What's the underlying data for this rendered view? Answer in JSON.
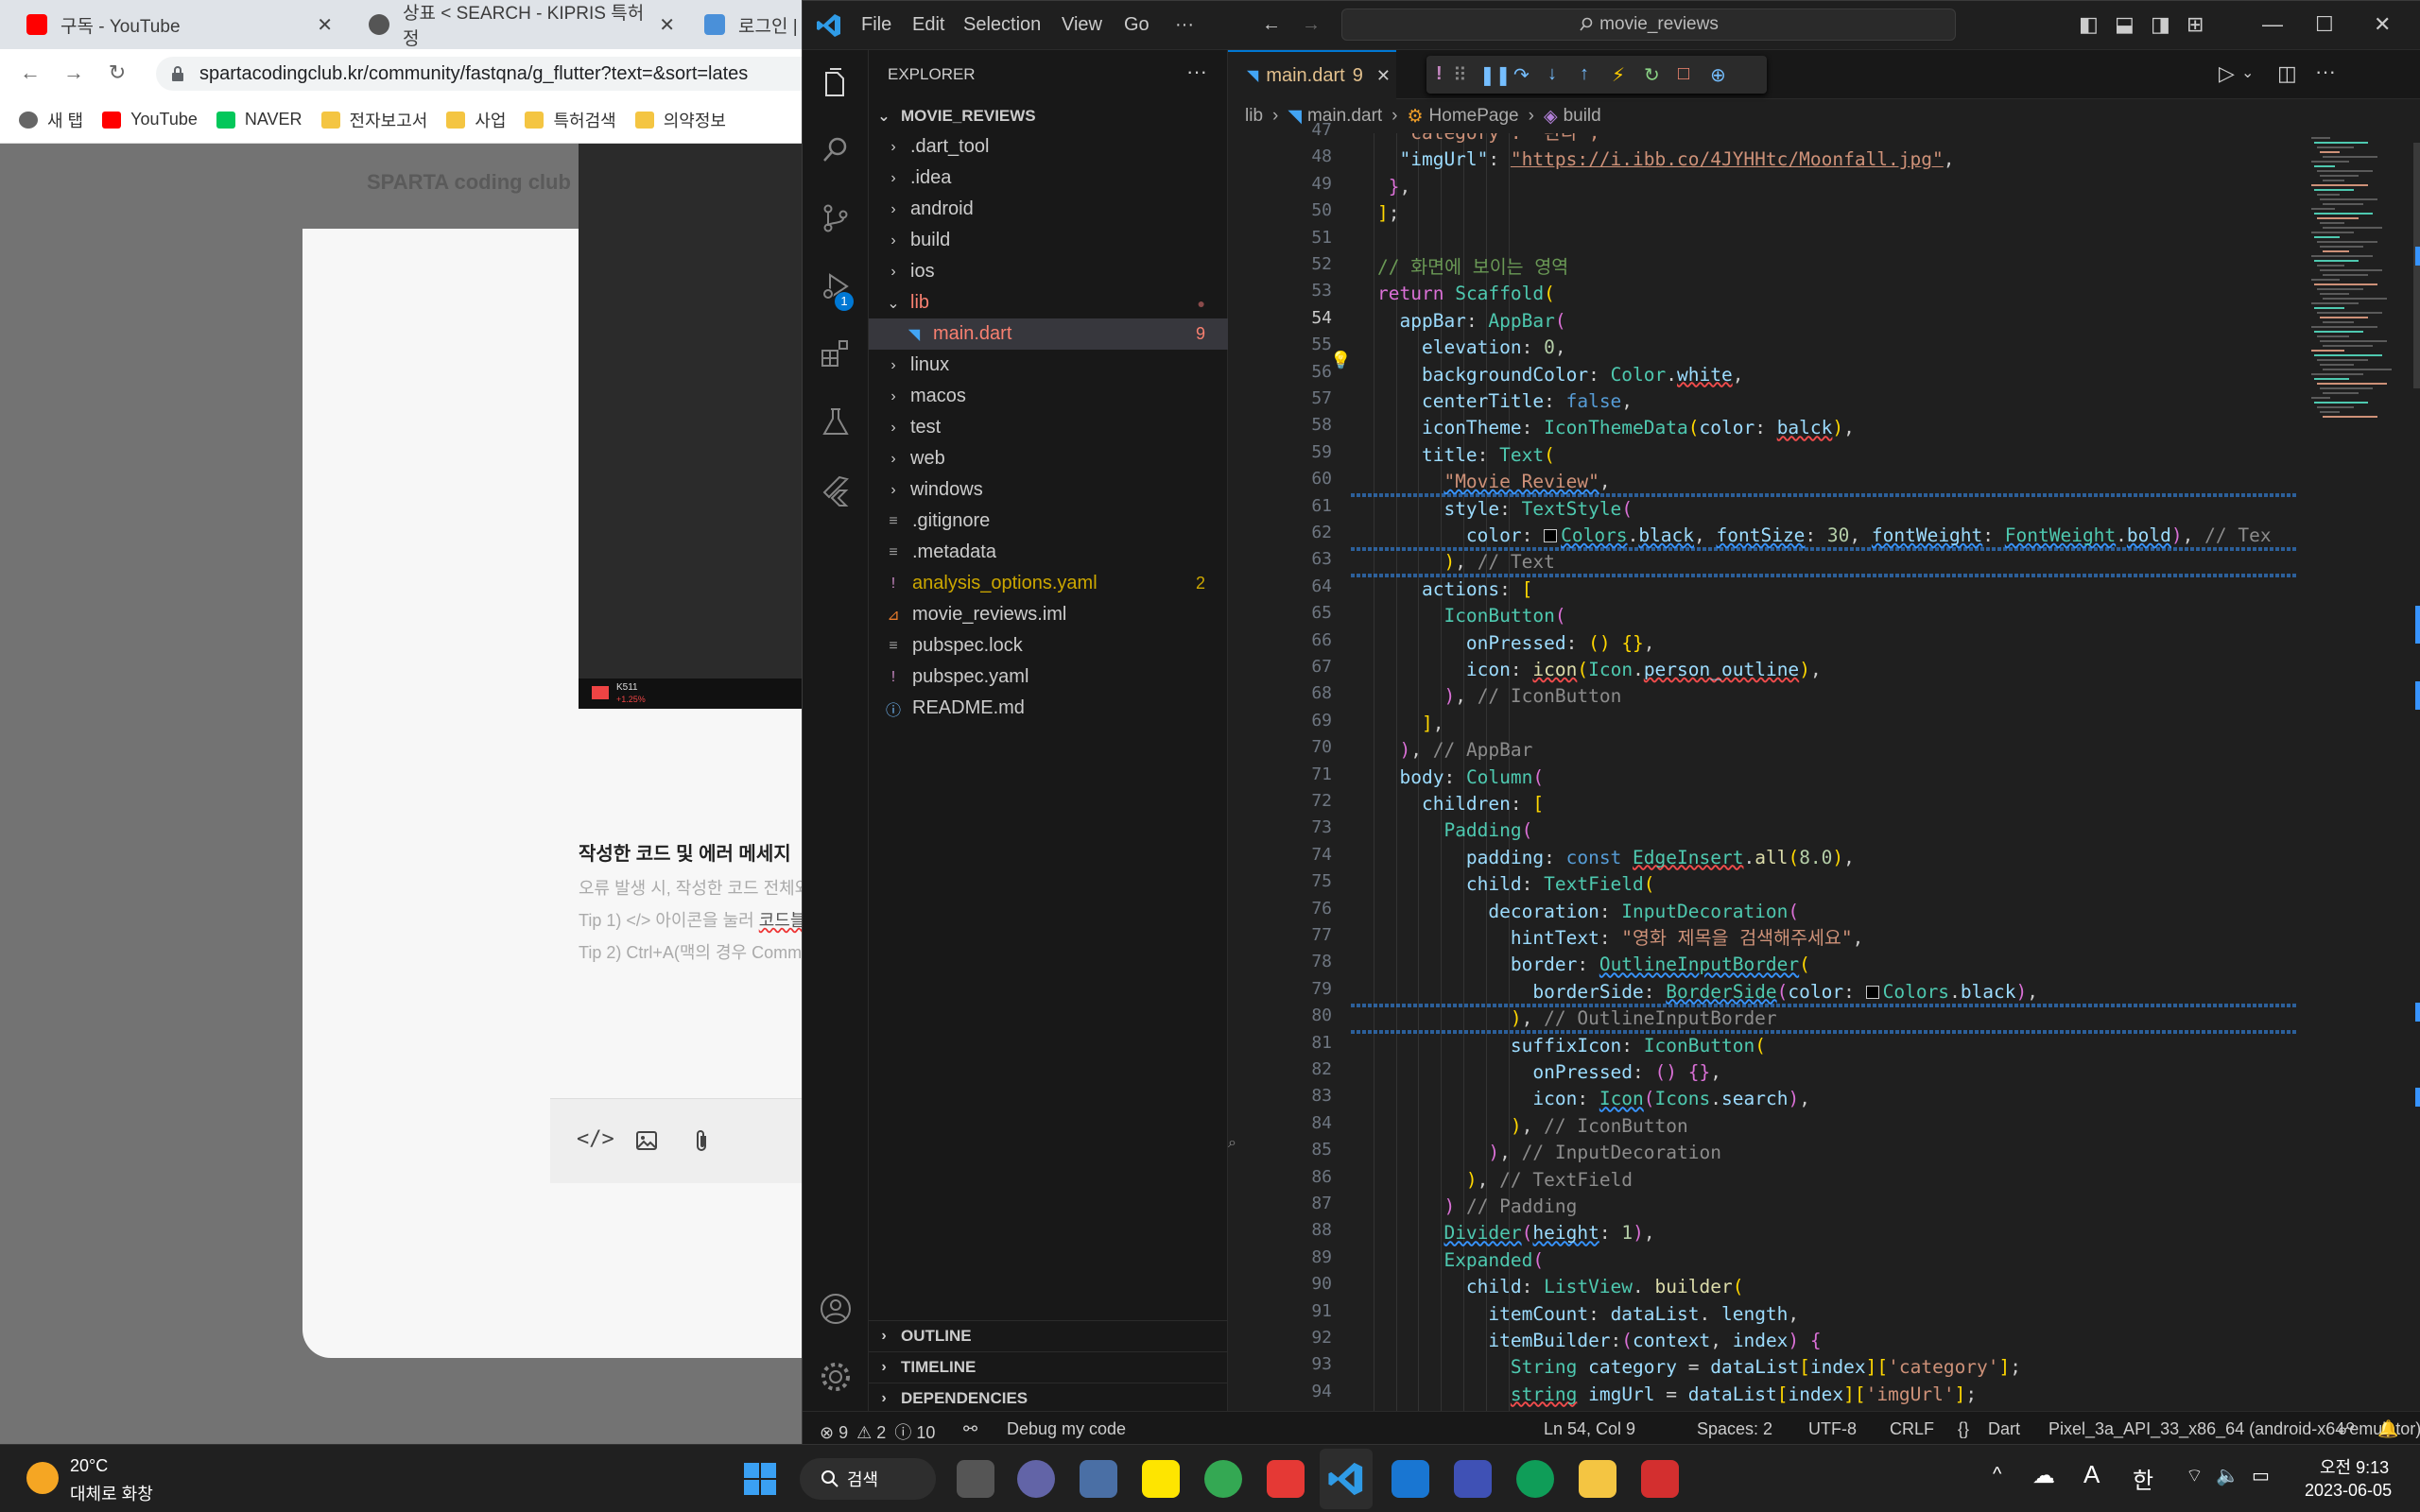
{
  "browser": {
    "tabs": [
      {
        "title": "구독 - YouTube",
        "close": "✕"
      },
      {
        "title": "상표 < SEARCH - KIPRIS 특허정",
        "close": "✕"
      },
      {
        "title": "로그인 |",
        "close": ""
      }
    ],
    "url": "spartacodingclub.kr/community/fastqna/g_flutter?text=&sort=lates",
    "bookmarks": [
      "새 탭",
      "YouTube",
      "NAVER",
      "전자보고서",
      "사업",
      "특허검색",
      "의약정보"
    ],
    "page": {
      "logo_text": "SPARTA coding club",
      "section_title": "작성한 코드 및 에러 메세지",
      "hint1": "오류 발생 시, 작성한 코드 전체와 (",
      "hint2_a": "Tip 1) </> 아이콘을 눌러 ",
      "hint2_b": "코드블",
      "hint3": "Tip 2) Ctrl+A(맥의 경우 Comma",
      "video_badge": "K511",
      "video_sub": "+1.25%"
    }
  },
  "vscode": {
    "menu": [
      "File",
      "Edit",
      "Selection",
      "View",
      "Go",
      "···"
    ],
    "command_center": "movie_reviews",
    "explorer": {
      "header": "EXPLORER",
      "header_more": "···",
      "project": "MOVIE_REVIEWS",
      "items": [
        {
          "label": ".dart_tool",
          "type": "folder"
        },
        {
          "label": ".idea",
          "type": "folder"
        },
        {
          "label": "android",
          "type": "folder"
        },
        {
          "label": "build",
          "type": "folder"
        },
        {
          "label": "ios",
          "type": "folder"
        },
        {
          "label": "lib",
          "type": "folder-open"
        },
        {
          "label": "main.dart",
          "type": "file",
          "badge": "9"
        },
        {
          "label": "linux",
          "type": "folder"
        },
        {
          "label": "macos",
          "type": "folder"
        },
        {
          "label": "test",
          "type": "folder"
        },
        {
          "label": "web",
          "type": "folder"
        },
        {
          "label": "windows",
          "type": "folder"
        },
        {
          "label": ".gitignore",
          "type": "file"
        },
        {
          "label": ".metadata",
          "type": "file"
        },
        {
          "label": "analysis_options.yaml",
          "type": "file",
          "badge": "2"
        },
        {
          "label": "movie_reviews.iml",
          "type": "file"
        },
        {
          "label": "pubspec.lock",
          "type": "file"
        },
        {
          "label": "pubspec.yaml",
          "type": "file"
        },
        {
          "label": "README.md",
          "type": "file"
        }
      ],
      "panels": [
        "OUTLINE",
        "TIMELINE",
        "DEPENDENCIES"
      ]
    },
    "tab": {
      "name": "main.dart",
      "badge": "9",
      "close": "✕"
    },
    "breadcrumb": [
      "lib",
      "main.dart",
      "HomePage",
      "build"
    ],
    "line_numbers": [
      "47",
      "48",
      "49",
      "50",
      "51",
      "52",
      "53",
      "54",
      "55",
      "56",
      "57",
      "58",
      "59",
      "60",
      "61",
      "62",
      "63",
      "64",
      "65",
      "66",
      "67",
      "68",
      "69",
      "70",
      "71",
      "72",
      "73",
      "74",
      "75",
      "76",
      "77",
      "78",
      "79",
      "80",
      "81",
      "82",
      "83",
      "84",
      "85",
      "86",
      "87",
      "88",
      "89",
      "90",
      "91",
      "92",
      "93",
      "94"
    ],
    "code": {
      "l47": "\"category\": \"판타\",",
      "l48_key": "\"imgUrl\"",
      "l48_val": "\"https://i.ibb.co/4JYHHtc/Moonfall.jpg\"",
      "l52": "// 화면에 보이는 영역",
      "l60": "\"Movie Review\"",
      "l62_tail": "// Tex",
      "l63": "// Text",
      "l68": "// IconButton",
      "l70": "// AppBar",
      "l77": "\"영화 제목을 검색해주세요\"",
      "l80": "// OutlineInputBorder",
      "l84": "// IconButton",
      "l85": "// InputDecoration",
      "l86": "// TextField",
      "l87": "// Padding",
      "l93_s": "'category'",
      "l94_s": "'imgUrl'"
    },
    "status": {
      "errors": "9",
      "warnings": "2",
      "infos": "10",
      "debug": "Debug my code",
      "position": "Ln 54, Col 9",
      "spaces": "Spaces: 2",
      "encoding": "UTF-8",
      "eol": "CRLF",
      "language": "Dart",
      "device": "Pixel_3a_API_33_x86_64 (android-x64 emulator)"
    }
  },
  "taskbar": {
    "weather_temp": "20°C",
    "weather_desc": "대체로 화창",
    "search": "검색",
    "ime_a": "A",
    "ime_han": "한",
    "time": "오전 9:13",
    "date": "2023-06-05"
  },
  "colors": {
    "accent": "#0078d4",
    "error": "#f14c4c",
    "warning": "#cca700",
    "modified": "#e2c08d"
  }
}
